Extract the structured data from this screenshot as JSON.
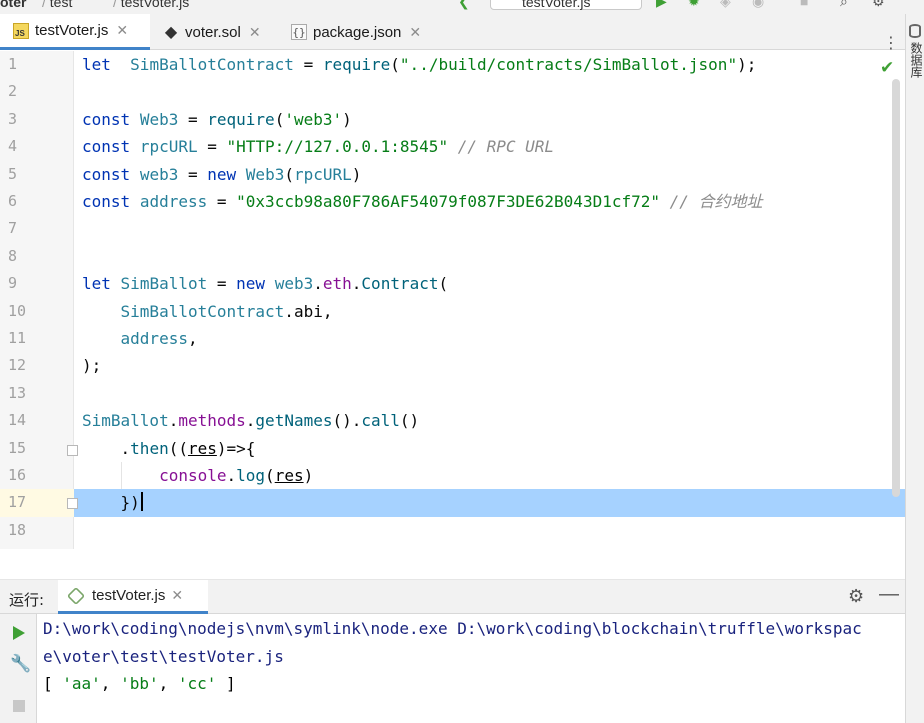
{
  "breadcrumb": {
    "project": "oter",
    "folder": "test",
    "file": "testVoter.js",
    "run_config": "testVoter.js"
  },
  "tabs": [
    {
      "label": "testVoter.js",
      "icon": "js-file-icon",
      "active": true
    },
    {
      "label": "voter.sol",
      "icon": "ethereum-icon",
      "active": false
    },
    {
      "label": "package.json",
      "icon": "json-file-icon",
      "active": false
    }
  ],
  "right_strip": {
    "label": "数据库"
  },
  "editor": {
    "line_numbers": [
      "1",
      "2",
      "3",
      "4",
      "5",
      "6",
      "7",
      "8",
      "9",
      "10",
      "11",
      "12",
      "13",
      "14",
      "15",
      "16",
      "17",
      "18"
    ],
    "current_line": 17,
    "lines": {
      "l1": {
        "kw": "let",
        "id": "SimBallotContract",
        "op": " = ",
        "fn": "require",
        "str": "\"../build/contracts/SimBallot.json\"",
        "end": ");"
      },
      "l3": {
        "kw": "const",
        "id": "Web3",
        "fn": "require",
        "str": "'web3'"
      },
      "l4": {
        "kw": "const",
        "id": "rpcURL",
        "str": "\"HTTP://127.0.0.1:8545\"",
        "comment": "// RPC URL"
      },
      "l5": {
        "kw": "const",
        "id": "web3",
        "kw2": "new",
        "cls": "Web3",
        "arg": "rpcURL"
      },
      "l6": {
        "kw": "const",
        "id": "address",
        "str": "\"0x3ccb98a80F786AF54079f087F3DE62B043D1cf72\"",
        "comment": "// 合约地址"
      },
      "l9": {
        "kw": "let",
        "id": "SimBallot",
        "kw2": "new",
        "obj": "web3",
        "prop": "eth",
        "cls": "Contract"
      },
      "l10": {
        "obj": "SimBallotContract",
        "prop": "abi"
      },
      "l11": {
        "id": "address"
      },
      "l12": {
        "text": ");"
      },
      "l14": {
        "obj": "SimBallot",
        "prop": "methods",
        "m1": "getNames",
        "m2": "call"
      },
      "l15": {
        "m": "then",
        "param": "res"
      },
      "l16": {
        "obj": "console",
        "m": "log",
        "param": "res"
      },
      "l17": {
        "text": "})"
      }
    }
  },
  "run_panel": {
    "label": "运行:",
    "tab": "testVoter.js",
    "output": {
      "line1": "D:\\work\\coding\\nodejs\\nvm\\symlink\\node.exe D:\\work\\coding\\blockchain\\truffle\\workspac",
      "line2": "e\\voter\\test\\testVoter.js",
      "result": [
        "'aa'",
        "'bb'",
        "'cc'"
      ]
    }
  },
  "colors": {
    "current_line_highlight": "#a6d2ff",
    "tab_active_underline": "#4083c9",
    "keyword": "#0033b3",
    "string": "#067d17"
  }
}
